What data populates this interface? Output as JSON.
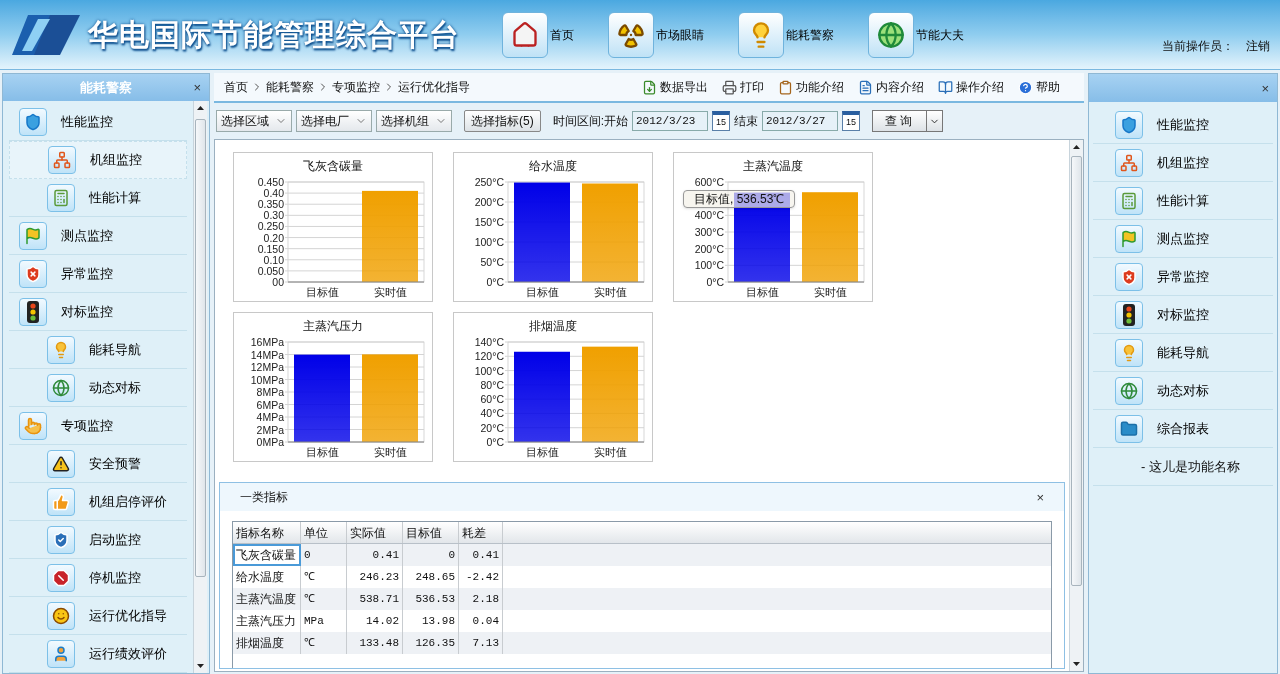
{
  "header": {
    "title": "华电国际节能管理综合平台",
    "nav": [
      {
        "label": "首页"
      },
      {
        "label": "市场眼睛"
      },
      {
        "label": "能耗警察"
      },
      {
        "label": "节能大夫"
      }
    ],
    "operator_label": "当前操作员：",
    "logout": "注销"
  },
  "left_panel": {
    "title": "能耗警察",
    "close": "×",
    "items": [
      {
        "label": "性能监控",
        "selected": false,
        "children": [
          {
            "label": "机组监控",
            "selected": true
          },
          {
            "label": "性能计算",
            "selected": false
          }
        ]
      },
      {
        "label": "测点监控",
        "selected": false
      },
      {
        "label": "异常监控",
        "selected": false
      },
      {
        "label": "对标监控",
        "selected": false,
        "children": [
          {
            "label": "能耗导航",
            "selected": false
          },
          {
            "label": "动态对标",
            "selected": false
          }
        ]
      },
      {
        "label": "专项监控",
        "selected": false,
        "children": [
          {
            "label": "安全预警",
            "selected": false
          },
          {
            "label": "机组启停评价",
            "selected": false
          },
          {
            "label": "启动监控",
            "selected": false
          },
          {
            "label": "停机监控",
            "selected": false
          },
          {
            "label": "运行优化指导",
            "selected": false
          },
          {
            "label": "运行绩效评价",
            "selected": false
          }
        ]
      }
    ]
  },
  "breadcrumb": [
    "首页",
    "能耗警察",
    "专项监控",
    "运行优化指导"
  ],
  "toolbar": [
    "数据导出",
    "打印",
    "功能介绍",
    "内容介绍",
    "操作介绍",
    "帮助"
  ],
  "filters": {
    "selects": [
      "选择区域",
      "选择电厂",
      "选择机组"
    ],
    "indicator_button": "选择指标(5)",
    "range_label": "时间区间:开始",
    "start_date": "2012/3/23",
    "start_calendar": "15",
    "end_label": "结束",
    "end_date": "2012/3/27",
    "end_calendar": "15",
    "query_button": "查 询"
  },
  "charts": [
    {
      "chart_data": {
        "type": "bar",
        "grid": true,
        "title": "飞灰含碳量",
        "categories": [
          "目标值",
          "实时值"
        ],
        "series": [
          {
            "color": "#0000e8",
            "values": [
              0,
              null
            ]
          },
          {
            "color": "#f0a000",
            "values": [
              null,
              0.41
            ]
          }
        ],
        "ylim": [
          0,
          0.45
        ],
        "yticks": [
          {
            "value": 0.45,
            "label": "0.450"
          },
          {
            "value": 0.4,
            "label": "0.40"
          },
          {
            "value": 0.35,
            "label": "0.350"
          },
          {
            "value": 0.3,
            "label": "0.30"
          },
          {
            "value": 0.25,
            "label": "0.250"
          },
          {
            "value": 0.2,
            "label": "0.20"
          },
          {
            "value": 0.15,
            "label": "0.150"
          },
          {
            "value": 0.1,
            "label": "0.10"
          },
          {
            "value": 0.05,
            "label": "0.050"
          },
          {
            "value": 0,
            "label": "00"
          }
        ]
      }
    },
    {
      "chart_data": {
        "type": "bar",
        "grid": true,
        "title": "给水温度",
        "categories": [
          "目标值",
          "实时值"
        ],
        "series": [
          {
            "color": "#0000e8",
            "values": [
              248.65,
              null
            ]
          },
          {
            "color": "#f0a000",
            "values": [
              null,
              246.23
            ]
          }
        ],
        "ylim": [
          0,
          250
        ],
        "yticks": [
          {
            "value": 250,
            "label": "250°C"
          },
          {
            "value": 200,
            "label": "200°C"
          },
          {
            "value": 150,
            "label": "150°C"
          },
          {
            "value": 100,
            "label": "100°C"
          },
          {
            "value": 50,
            "label": "50°C"
          },
          {
            "value": 0,
            "label": "0°C"
          }
        ]
      }
    },
    {
      "chart_data": {
        "type": "bar",
        "grid": true,
        "title": "主蒸汽温度",
        "categories": [
          "目标值",
          "实时值"
        ],
        "series": [
          {
            "color": "#0000e8",
            "values": [
              536.53,
              null
            ]
          },
          {
            "color": "#f0a000",
            "values": [
              null,
              538.71
            ]
          }
        ],
        "ylim": [
          0,
          600
        ],
        "yticks": [
          {
            "value": 600,
            "label": "600°C"
          },
          {
            "value": 400,
            "label": "400°C"
          },
          {
            "value": 300,
            "label": "300°C"
          },
          {
            "value": 200,
            "label": "200°C"
          },
          {
            "value": 100,
            "label": "100°C"
          },
          {
            "value": 0,
            "label": "0°C"
          }
        ]
      },
      "tooltip": "目标值, 536.53℃"
    },
    {
      "chart_data": {
        "type": "bar",
        "grid": true,
        "title": "主蒸汽压力",
        "categories": [
          "目标值",
          "实时值"
        ],
        "series": [
          {
            "color": "#0000e8",
            "values": [
              13.98,
              null
            ]
          },
          {
            "color": "#f0a000",
            "values": [
              null,
              14.02
            ]
          }
        ],
        "ylim": [
          0,
          16
        ],
        "yticks": [
          {
            "value": 16,
            "label": "16MPa"
          },
          {
            "value": 14,
            "label": "14MPa"
          },
          {
            "value": 12,
            "label": "12MPa"
          },
          {
            "value": 10,
            "label": "10MPa"
          },
          {
            "value": 8,
            "label": "8MPa"
          },
          {
            "value": 6,
            "label": "6MPa"
          },
          {
            "value": 4,
            "label": "4MPa"
          },
          {
            "value": 2,
            "label": "2MPa"
          },
          {
            "value": 0,
            "label": "0MPa"
          }
        ]
      }
    },
    {
      "chart_data": {
        "type": "bar",
        "grid": true,
        "title": "排烟温度",
        "categories": [
          "目标值",
          "实时值"
        ],
        "series": [
          {
            "color": "#0000e8",
            "values": [
              126.35,
              null
            ]
          },
          {
            "color": "#f0a000",
            "values": [
              null,
              133.48
            ]
          }
        ],
        "ylim": [
          0,
          140
        ],
        "yticks": [
          {
            "value": 140,
            "label": "140°C"
          },
          {
            "value": 120,
            "label": "120°C"
          },
          {
            "value": 100,
            "label": "100°C"
          },
          {
            "value": 80,
            "label": "80°C"
          },
          {
            "value": 60,
            "label": "60°C"
          },
          {
            "value": 40,
            "label": "40°C"
          },
          {
            "value": 20,
            "label": "20°C"
          },
          {
            "value": 0,
            "label": "0°C"
          }
        ]
      }
    }
  ],
  "indicator_panel": {
    "title": "一类指标",
    "close": "×",
    "table": {
      "columns": [
        "指标名称",
        "单位",
        "实际值",
        "目标值",
        "耗差"
      ],
      "rows": [
        {
          "cells": [
            "飞灰含碳量",
            "0",
            "0.41",
            "0",
            "0.41"
          ],
          "selected": true
        },
        {
          "cells": [
            "给水温度",
            "℃",
            "246.23",
            "248.65",
            "-2.42"
          ],
          "selected": false
        },
        {
          "cells": [
            "主蒸汽温度",
            "℃",
            "538.71",
            "536.53",
            "2.18"
          ],
          "selected": false
        },
        {
          "cells": [
            "主蒸汽压力",
            "MPa",
            "14.02",
            "13.98",
            "0.04"
          ],
          "selected": false
        },
        {
          "cells": [
            "排烟温度",
            "℃",
            "133.48",
            "126.35",
            "7.13"
          ],
          "selected": false
        }
      ]
    }
  },
  "right_panel": {
    "close": "×",
    "items": [
      {
        "label": "性能监控"
      },
      {
        "label": "机组监控"
      },
      {
        "label": "性能计算"
      },
      {
        "label": "测点监控"
      },
      {
        "label": "异常监控"
      },
      {
        "label": "对标监控"
      },
      {
        "label": "能耗导航"
      },
      {
        "label": "动态对标"
      },
      {
        "label": "综合报表"
      }
    ],
    "footer": "- 这儿是功能名称"
  }
}
